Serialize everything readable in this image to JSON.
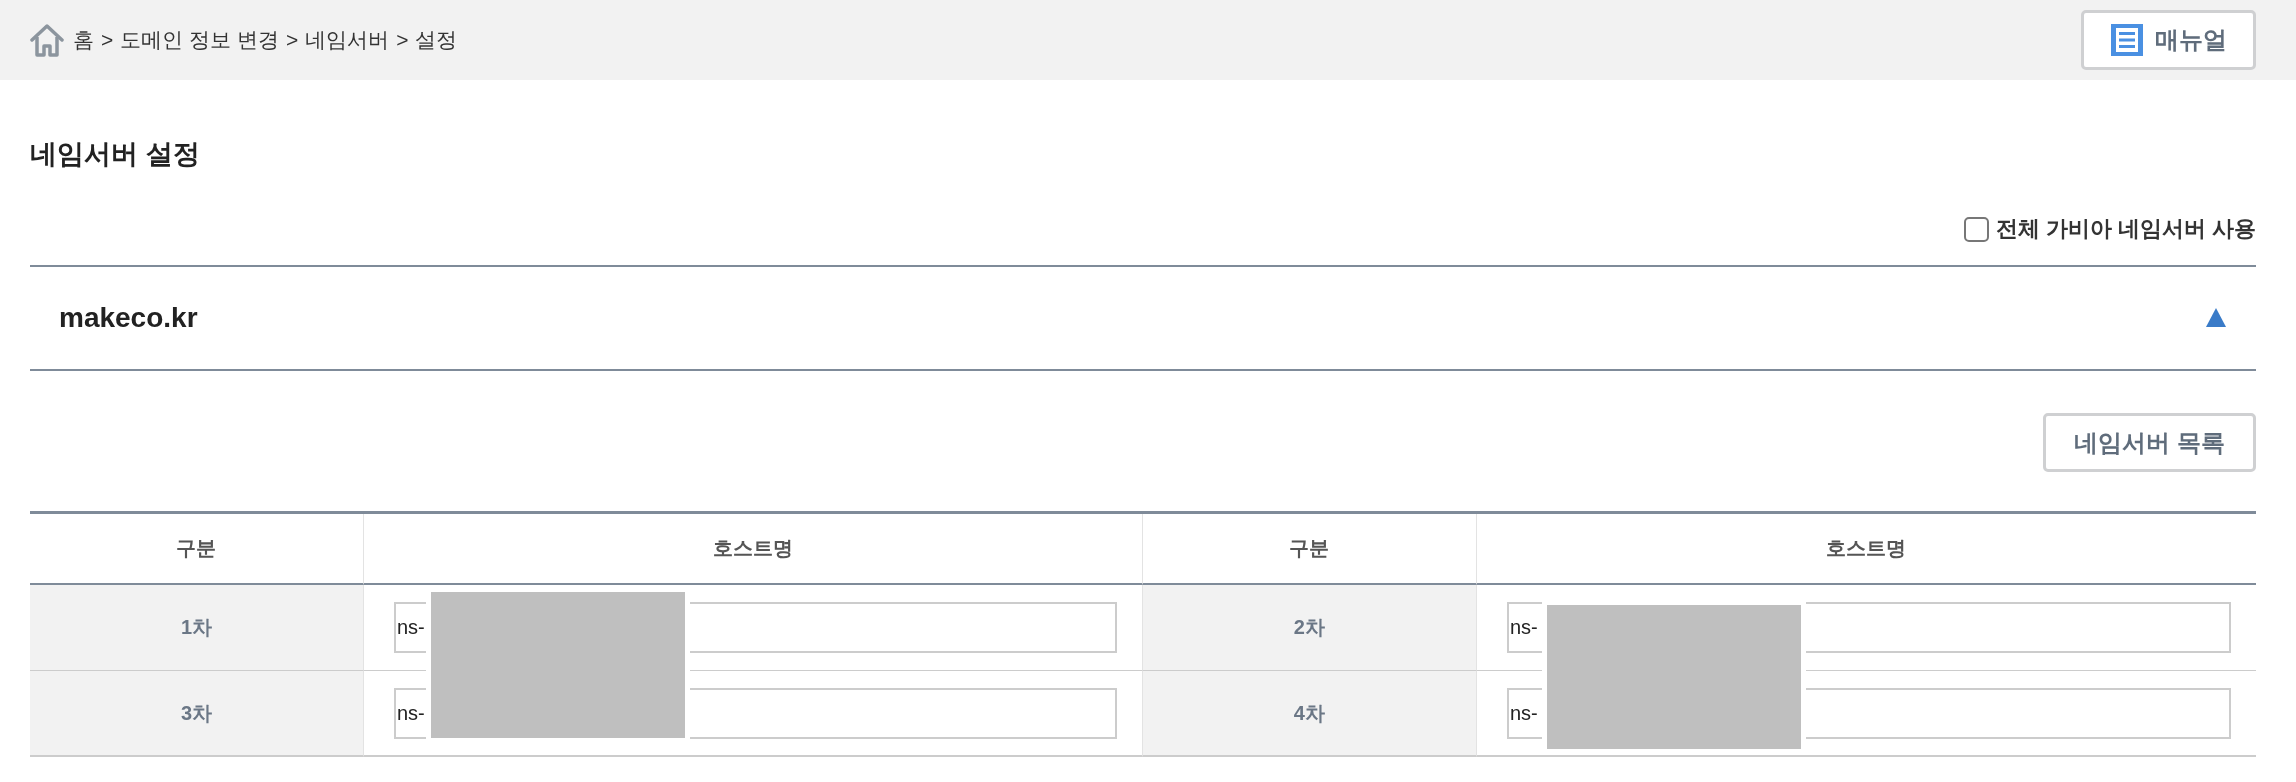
{
  "breadcrumb": [
    {
      "kind": "home",
      "text": "홈"
    },
    {
      "kind": "separator",
      "text": ">"
    },
    {
      "kind": "link",
      "text": "도메인 정보 변경"
    },
    {
      "kind": "separator",
      "text": ">"
    },
    {
      "kind": "link",
      "text": "네임서버"
    },
    {
      "kind": "separator",
      "text": ">"
    },
    {
      "kind": "current",
      "text": "설정"
    }
  ],
  "manual_button": {
    "label": "매뉴얼"
  },
  "page_title": "네임서버 설정",
  "use_all_gabia_ns": {
    "label": "전체 가비아 네임서버 사용",
    "checked": false
  },
  "domain": {
    "name": "makeco.kr",
    "expanded": true
  },
  "list_button": {
    "label": "네임서버 목록"
  },
  "table": {
    "columns": [
      "구분",
      "호스트명",
      "구분",
      "호스트명"
    ],
    "rows": [
      [
        {
          "label": "1차",
          "value": "ns-"
        },
        {
          "label": "2차",
          "value": "ns-"
        }
      ],
      [
        {
          "label": "3차",
          "value": "ns-"
        },
        {
          "label": "4차",
          "value": "ns-"
        }
      ]
    ],
    "hostnames_redacted": true
  }
}
